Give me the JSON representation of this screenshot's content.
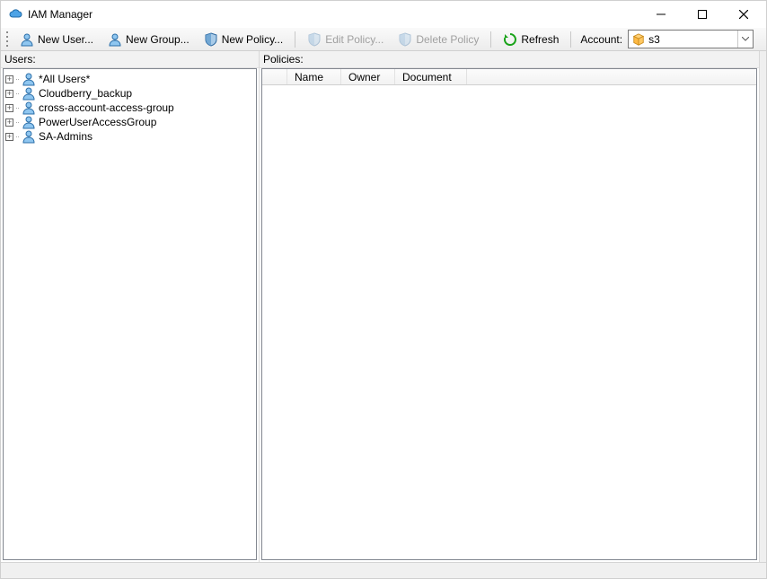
{
  "window": {
    "title": "IAM Manager"
  },
  "toolbar": {
    "new_user": "New User...",
    "new_group": "New Group...",
    "new_policy": "New Policy...",
    "edit_policy": "Edit Policy...",
    "delete_policy": "Delete Policy",
    "refresh": "Refresh",
    "account_label": "Account:",
    "account_value": "s3"
  },
  "panes": {
    "users_label": "Users:",
    "policies_label": "Policies:"
  },
  "users_tree": {
    "items": [
      {
        "label": "*All Users*"
      },
      {
        "label": "Cloudberry_backup"
      },
      {
        "label": "cross-account-access-group"
      },
      {
        "label": "PowerUserAccessGroup"
      },
      {
        "label": "SA-Admins"
      }
    ]
  },
  "policies_table": {
    "columns": {
      "name": "Name",
      "owner": "Owner",
      "document": "Document"
    },
    "rows": []
  }
}
